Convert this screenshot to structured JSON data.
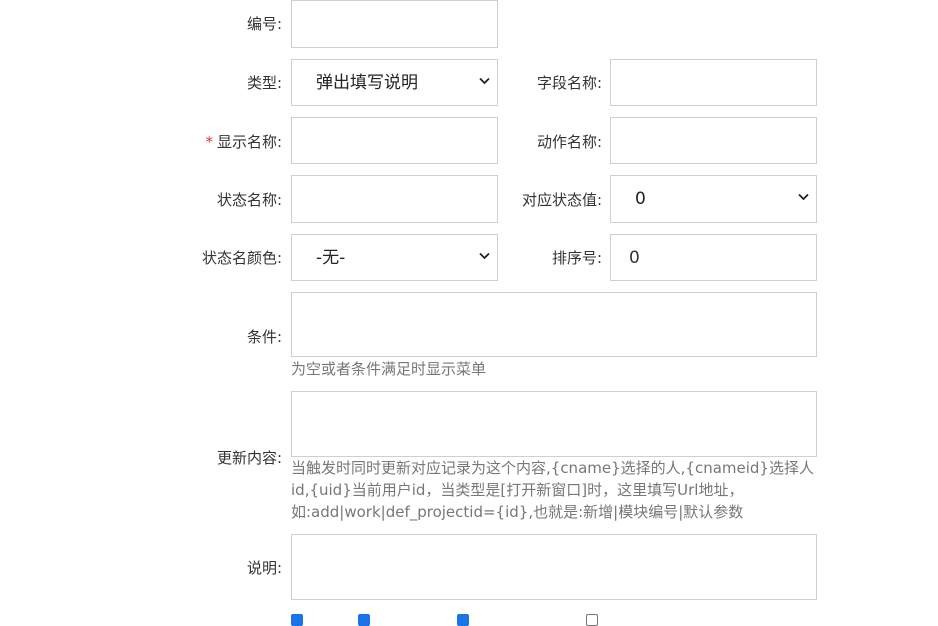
{
  "form": {
    "bianhao": {
      "label": "编号:",
      "value": ""
    },
    "type": {
      "label": "类型:",
      "selected": "弹出填写说明"
    },
    "field_name": {
      "label": "字段名称:",
      "value": ""
    },
    "display_name": {
      "required_mark": "*",
      "label": "显示名称:",
      "value": ""
    },
    "action_name": {
      "label": "动作名称:",
      "value": ""
    },
    "status_name": {
      "label": "状态名称:",
      "value": ""
    },
    "status_value": {
      "label": "对应状态值:",
      "selected": "0"
    },
    "status_color": {
      "label": "状态名颜色:",
      "selected": "-无-"
    },
    "sort": {
      "label": "排序号:",
      "value": "0"
    },
    "condition": {
      "label": "条件:",
      "value": "",
      "hint": "为空或者条件满足时显示菜单"
    },
    "update_content": {
      "label": "更新内容:",
      "value": "",
      "hint_lines": [
        "当触发时同时更新对应记录为这个内容,{cname}选择的人,{cnameid}选择人",
        "id,{uid}当前用户id，当类型是[打开新窗口]时，这里填写Url地址，",
        "如:add|work|def_projectid={id},也就是:新增|模块编号|默认参数"
      ]
    },
    "description": {
      "label": "说明:",
      "value": ""
    },
    "checkboxes": [
      {
        "checked": true
      },
      {
        "checked": true
      },
      {
        "checked": true
      },
      {
        "checked": false
      }
    ]
  },
  "icons": {
    "select_arrow": "chevron-down-icon"
  },
  "colors": {
    "required": "#e23b3b",
    "checkbox_checked": "#1b73e8",
    "border": "#cfcfcf",
    "hint": "#777777"
  }
}
